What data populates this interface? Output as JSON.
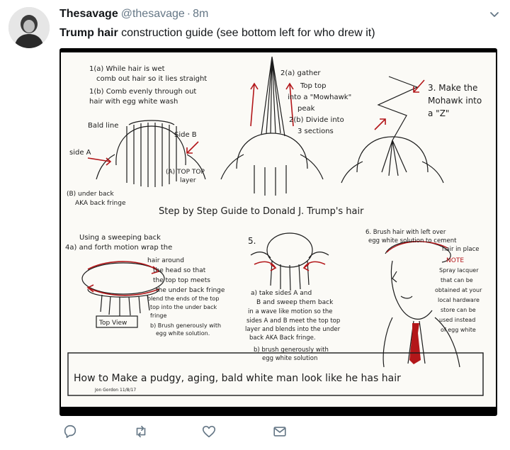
{
  "tweet": {
    "display_name": "Thesavage",
    "handle": "@thesavage",
    "separator": "·",
    "time": "8m",
    "text_bold": "Trump hair",
    "text_rest": " construction guide (see bottom left for who drew it)"
  },
  "media": {
    "step_1a": "1(a) While hair is wet",
    "step_1a_2": "comb out hair so it lies straight",
    "step_1b": "1(b) Comb evenly through out",
    "step_1b_2": "hair with egg white wash",
    "bald_line": "Bald line",
    "side_a": "side A",
    "side_b": "Side B",
    "top_top": "(A) TOP TOP",
    "top_top_2": "layer",
    "under_back": "(B) under back",
    "under_back_2": "AKA back fringe",
    "step_2a": "2(a) gather",
    "step_2a_2": "Top top",
    "step_2a_3": "into a \"Mowhawk\"",
    "step_2a_4": "peak",
    "step_2b": "2(b) Divide into",
    "step_2b_2": "3 sections",
    "step_3": "3. Make the",
    "step_3_2": "Mohawk into",
    "step_3_3": "a \"Z\"",
    "title": "Step by Step Guide to Donald J. Trump's hair",
    "step_4a": "Using a sweeping back",
    "step_4a_2": "4a) and forth motion wrap the",
    "step_4a_3": "hair around",
    "step_4a_4": "the head so that",
    "step_4a_5": "the top top meets",
    "step_4a_6": "the under back fringe",
    "step_4a_7": "blend the ends of the top",
    "step_4a_8": "top into the under back",
    "step_4a_9": "fringe",
    "top_view": "Top View",
    "step_4b": "b) Brush generously with",
    "step_4b_2": "egg white solution.",
    "step_5": "5.",
    "step_5a": "a) take sides A and",
    "step_5a_2": "B and sweep them back",
    "step_5a_3": "in a wave like motion so the",
    "step_5a_4": "sides A and B meet the top top",
    "step_5a_5": "layer and blends into the under",
    "step_5a_6": "back AKA Back fringe.",
    "step_5b": "b) brush generously with",
    "step_5b_2": "egg white solution",
    "step_6": "6. Brush hair with left over",
    "step_6_2": "egg white solution to cement",
    "step_6_3": "hair in place",
    "note_title": "NOTE",
    "note_1": "Spray lacquer",
    "note_2": "that can be",
    "note_3": "obtained at your",
    "note_4": "local hardware",
    "note_5": "store can be",
    "note_6": "used instead",
    "note_7": "of egg white",
    "banner": "How to Make a pudgy, aging, bald white man look like he has hair",
    "signature": "Jon Gordon 11/8/17"
  },
  "colors": {
    "name": "#14171a",
    "meta": "#657786",
    "action_icon": "#657786",
    "paper": "#fbfaf6",
    "ink": "#1c1c1c",
    "red_ink": "#b3171a"
  },
  "actions": {
    "reply_icon": "reply-icon",
    "retweet_icon": "retweet-icon",
    "like_icon": "heart-icon",
    "dm_icon": "envelope-icon"
  }
}
